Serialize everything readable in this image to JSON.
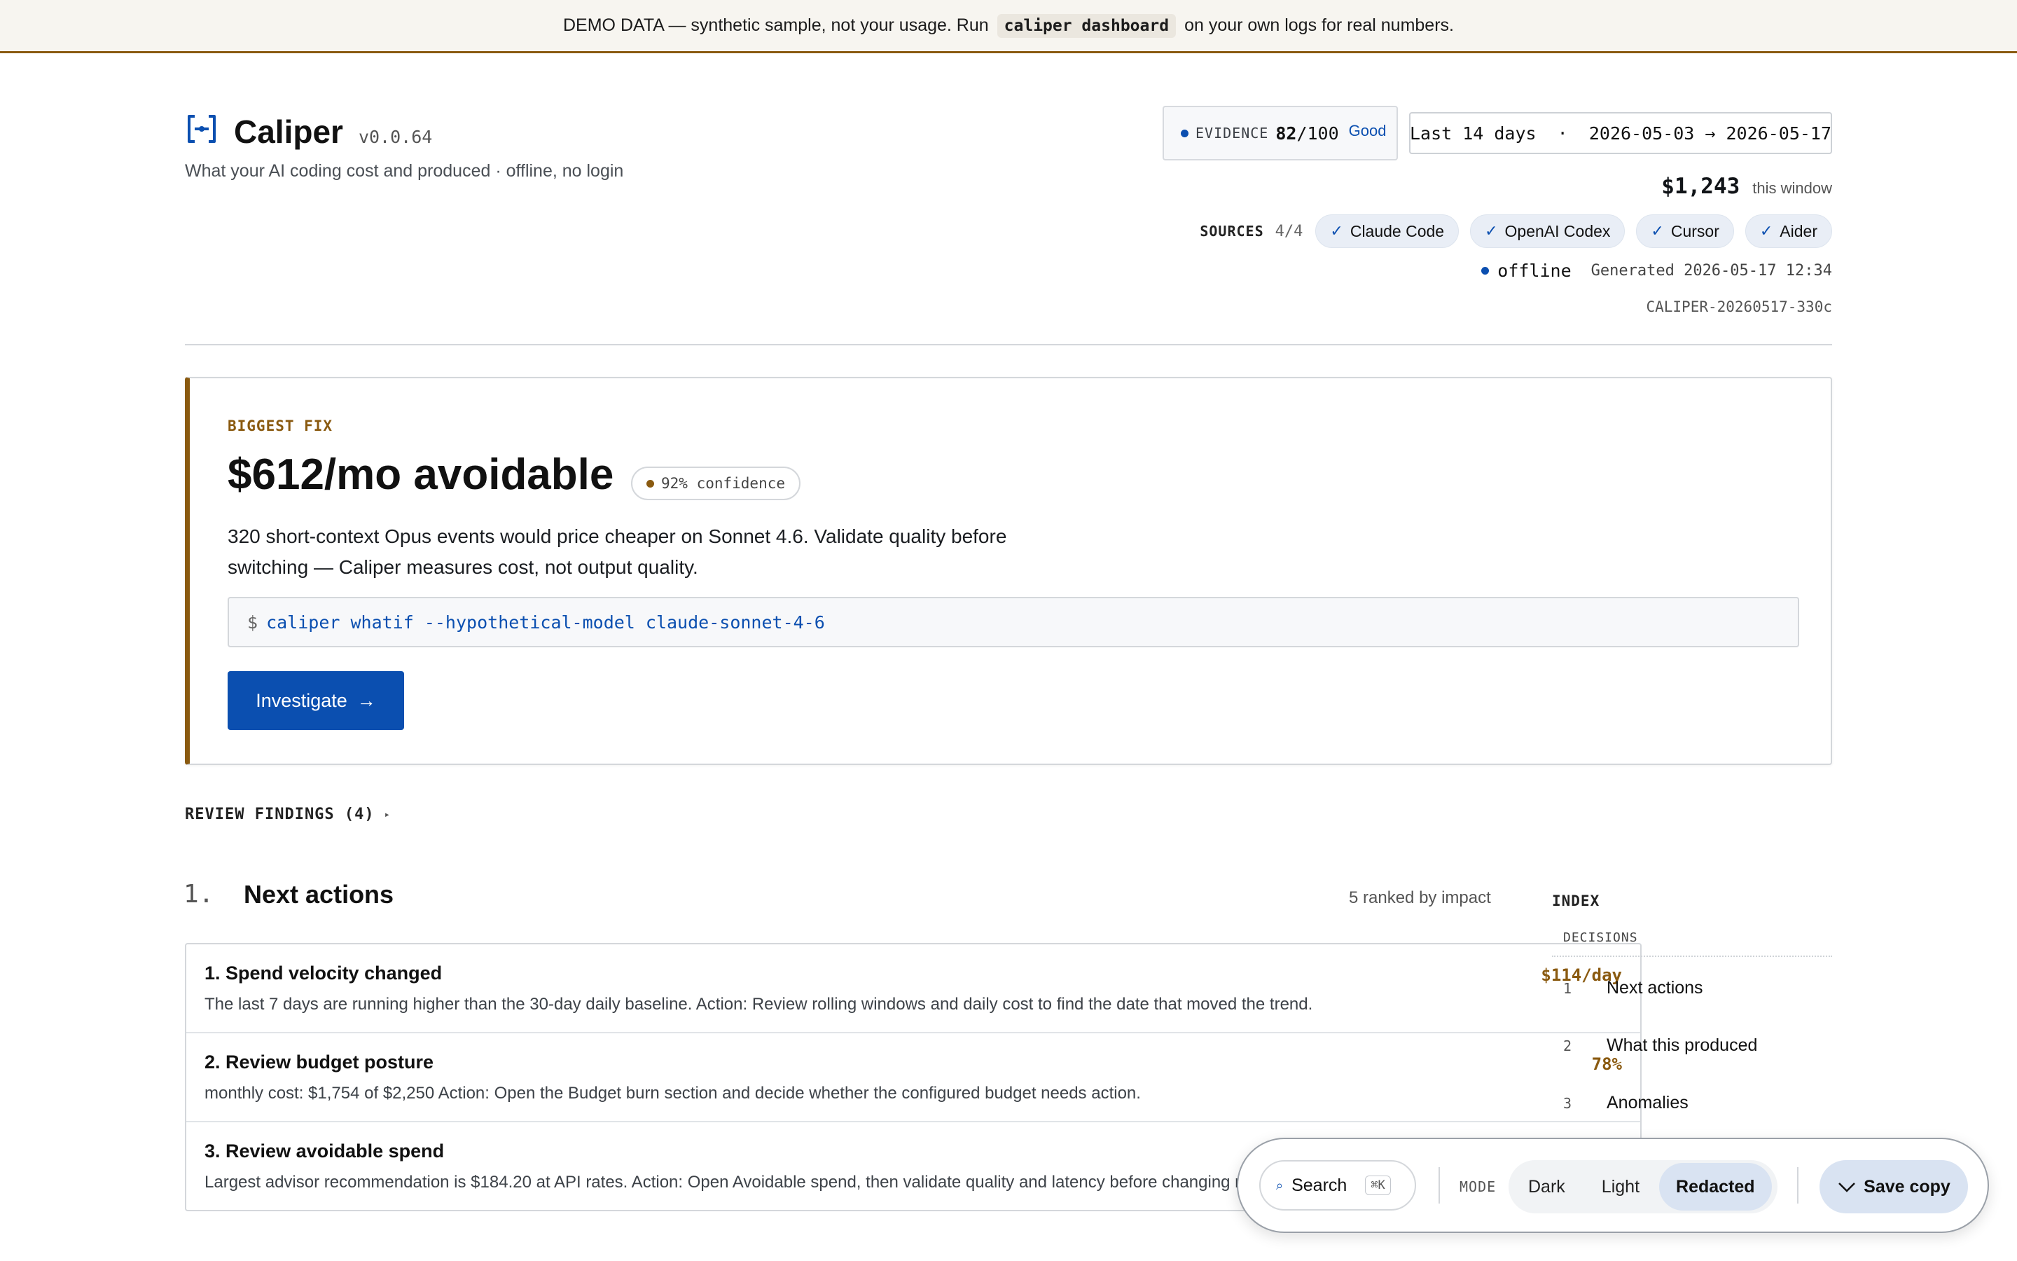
{
  "banner": {
    "lead": "DEMO DATA — synthetic sample, not your usage. Run",
    "command": "caliper dashboard",
    "tail": "on your own logs for real numbers."
  },
  "header": {
    "app_name": "Caliper",
    "version": "v0.0.64",
    "tagline": "What your AI coding cost and produced · offline, no login",
    "evidence": {
      "label": "EVIDENCE",
      "score": "82",
      "max": "/100",
      "rating": "Good"
    },
    "range": "Last 14 days  ·  2026-05-03 → 2026-05-17",
    "total": {
      "amount": "$1,243",
      "label": "this window"
    },
    "sources": {
      "label": "SOURCES",
      "count": "4/4",
      "items": [
        "Claude Code",
        "OpenAI Codex",
        "Cursor",
        "Aider"
      ]
    },
    "status": {
      "mode": "offline",
      "generated": "Generated 2026-05-17 12:34"
    },
    "report_id": "CALIPER-20260517-330c"
  },
  "biggest_fix": {
    "eyebrow": "BIGGEST FIX",
    "headline": "$612/mo avoidable",
    "confidence": "92% confidence",
    "description": "320 short-context Opus events would price cheaper on Sonnet 4.6. Validate quality before switching — Caliper measures cost, not output quality.",
    "prompt": "$",
    "command": "caliper whatif --hypothetical-model claude-sonnet-4-6",
    "button": "Investigate",
    "button_arrow": "→"
  },
  "review": {
    "label": "REVIEW FINDINGS (4)",
    "toggle": "▸"
  },
  "next_actions": {
    "number": "1.",
    "title": "Next actions",
    "meta": "5 ranked by impact",
    "items": [
      {
        "title": "1. Spend velocity changed",
        "value": "$114/day",
        "desc": "The last 7 days are running higher than the 30-day daily baseline. Action: Review rolling windows and daily cost to find the date that moved the trend."
      },
      {
        "title": "2. Review budget posture",
        "value": "78%",
        "desc": "monthly cost: $1,754 of $2,250 Action: Open the Budget burn section and decide whether the configured budget needs action."
      },
      {
        "title": "3. Review avoidable spend",
        "value": "",
        "desc": "Largest advisor recommendation is $184.20 at API rates. Action: Open Avoidable spend, then validate quality and latency before changing routing."
      }
    ]
  },
  "index": {
    "title": "INDEX",
    "group": "DECISIONS",
    "items": [
      {
        "n": "1",
        "label": "Next actions"
      },
      {
        "n": "2",
        "label": "What this produced"
      },
      {
        "n": "3",
        "label": "Anomalies"
      }
    ]
  },
  "toolbar": {
    "search": "Search",
    "shortcut": "⌘K",
    "mode_label": "MODE",
    "modes": [
      "Dark",
      "Light",
      "Redacted"
    ],
    "active_mode": "Redacted",
    "save": "Save copy"
  },
  "colors": {
    "accent": "#0b4fb0",
    "warning": "#8a5a10",
    "chip_bg": "#e9eef6"
  }
}
